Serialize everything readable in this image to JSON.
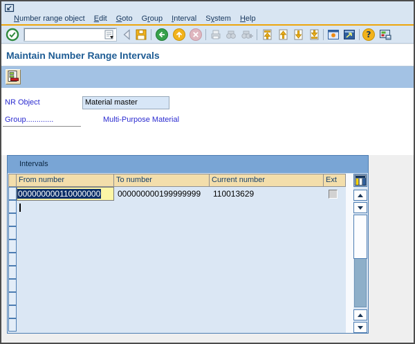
{
  "menu": {
    "items": [
      {
        "label": "Number range object",
        "accel_index": 0
      },
      {
        "label": "Edit",
        "accel_index": 0
      },
      {
        "label": "Goto",
        "accel_index": 0
      },
      {
        "label": "Group",
        "accel_index": 1
      },
      {
        "label": "Interval",
        "accel_index": 0
      },
      {
        "label": "System",
        "accel_index": 1
      },
      {
        "label": "Help",
        "accel_index": 0
      }
    ]
  },
  "toolbar": {
    "command_value": "",
    "icon_names": [
      "enter-check",
      "command-field-dropdown",
      "back-step",
      "save",
      "back-circle",
      "exit-circle",
      "cancel-circle",
      "print",
      "find",
      "find-next",
      "first-page",
      "page-up",
      "page-down",
      "last-page",
      "new-session",
      "create-shortcut",
      "help",
      "customize-layout"
    ]
  },
  "header": {
    "title": "Maintain Number Range Intervals"
  },
  "app_toolbar": {
    "icon_names": [
      "display-intervals"
    ]
  },
  "form": {
    "nr_object": {
      "label": "NR Object",
      "value": "Material master"
    },
    "group": {
      "label": "Group.............",
      "value": "Multi-Purpose Material"
    }
  },
  "intervals": {
    "caption": "Intervals",
    "columns": [
      "From number",
      "To number",
      "Current number",
      "Ext"
    ],
    "rows": [
      {
        "from_number": "000000000110000000",
        "to_number": "000000000199999999",
        "current_number": "110013629",
        "ext_checked": false
      }
    ],
    "visible_empty_rows": 10
  },
  "colors": {
    "accent_orange_line": "#eda50a",
    "topbar_blue": "#d8e5f2",
    "appbar_blue": "#a3c2e4",
    "panel_caption_blue": "#79a5d5",
    "panel_body_blue": "#dbe7f4",
    "header_cell_tan": "#f3deab",
    "selected_cell_yellow": "#fcf6a6",
    "selection_navy": "#0b2e68",
    "label_blue": "#2a2ad0",
    "title_blue": "#1e5c94"
  }
}
